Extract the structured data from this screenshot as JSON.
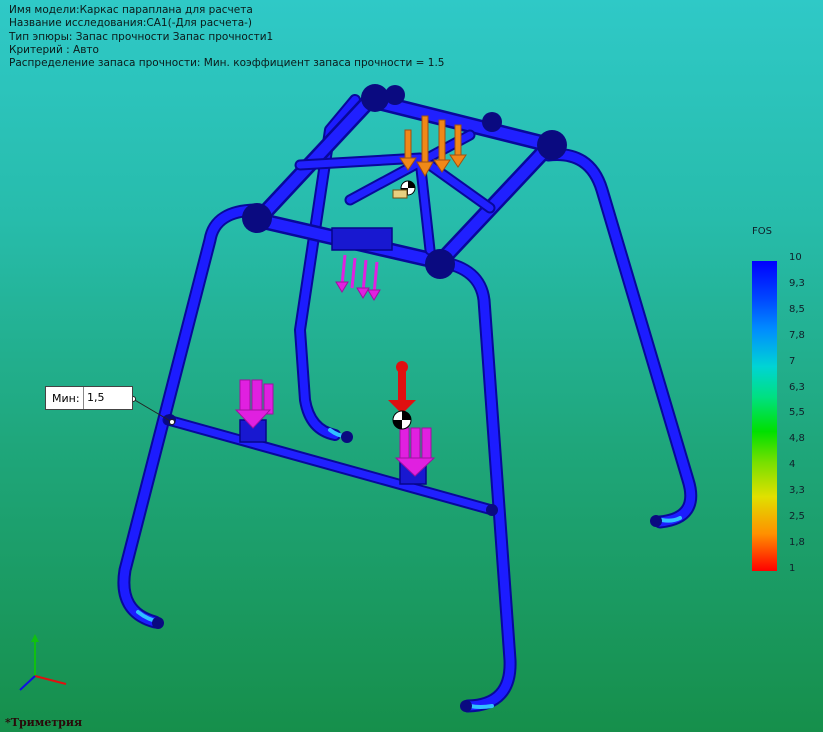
{
  "info": {
    "model": "Имя модели:Каркас параплана для расчета",
    "study": "Название исследования:CA1(-Для расчета-)",
    "plot_type": "Тип эпюры: Запас прочности Запас прочности1",
    "criterion": "Критерий : Авто",
    "distribution": "Распределение запаса прочности: Мин. коэффициент запаса прочности = 1.5"
  },
  "legend": {
    "title": "FOS",
    "ticks": [
      "10",
      "9,3",
      "8,5",
      "7,8",
      "7",
      "6,3",
      "5,5",
      "4,8",
      "4",
      "3,3",
      "2,5",
      "1,8",
      "1"
    ]
  },
  "min_marker": {
    "label": "Мин:",
    "value": "1,5"
  },
  "view": {
    "name": "*Триметрия"
  },
  "colors": {
    "frame": "#1a1aff",
    "frame_dark": "#0a0ab0",
    "force": "#e020e0",
    "load": "#e87a10",
    "gravity": "#e01010"
  }
}
